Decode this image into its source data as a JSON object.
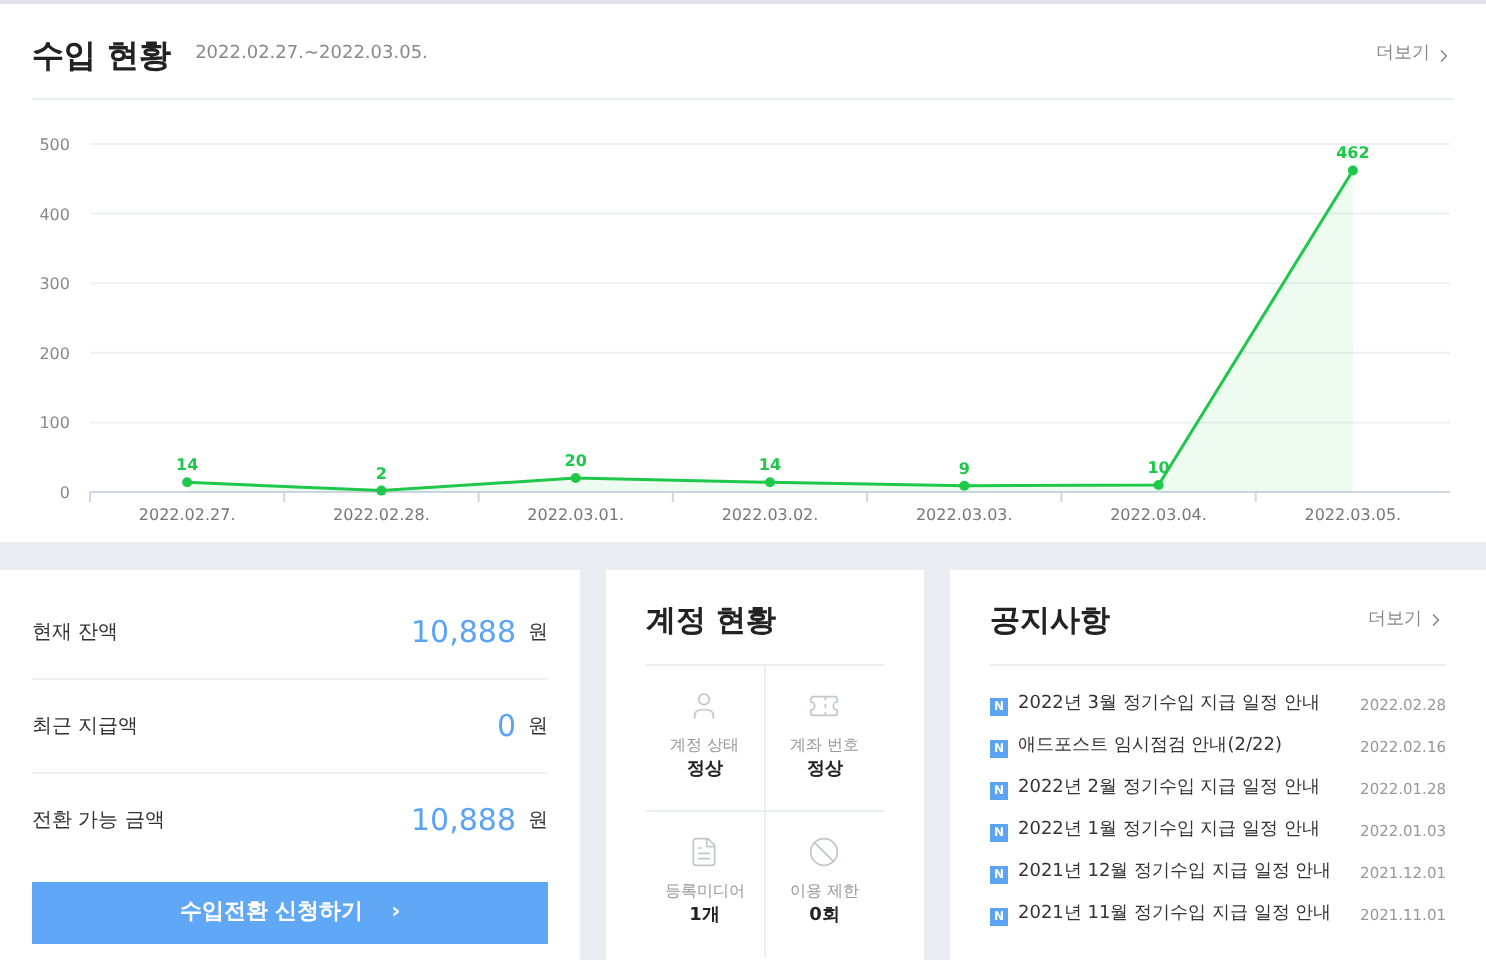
{
  "revenue": {
    "title": "수입 현황",
    "period": "2022.02.27.~2022.03.05.",
    "more": "더보기",
    "chart_data": {
      "type": "area",
      "categories": [
        "2022.02.27.",
        "2022.02.28.",
        "2022.03.01.",
        "2022.03.02.",
        "2022.03.03.",
        "2022.03.04.",
        "2022.03.05."
      ],
      "grid": true,
      "series": [
        {
          "color": "#1fc74a",
          "values": [
            14,
            2,
            20,
            14,
            9,
            10,
            462
          ]
        }
      ],
      "ylim": [
        0,
        500
      ],
      "yticks": [
        0,
        100,
        200,
        300,
        400,
        500
      ],
      "data_labels": true
    }
  },
  "balance": {
    "rows": [
      {
        "label": "현재 잔액",
        "amount": "10,888",
        "unit": "원"
      },
      {
        "label": "최근 지급액",
        "amount": "0",
        "unit": "원"
      },
      {
        "label": "전환 가능 금액",
        "amount": "10,888",
        "unit": "원"
      }
    ],
    "button": "수입전환 신청하기",
    "button_arrow": "›"
  },
  "account": {
    "title": "계정 현황",
    "items": [
      {
        "kind": "user",
        "label": "계정 상태",
        "value": "정상"
      },
      {
        "kind": "bank",
        "label": "계좌 번호",
        "value": "정상"
      },
      {
        "kind": "media",
        "label": "등록미디어",
        "value": "1개"
      },
      {
        "kind": "limit",
        "label": "이용 제한",
        "value": "0회"
      }
    ]
  },
  "notices": {
    "title": "공지사항",
    "more": "더보기",
    "items": [
      {
        "badge": "N",
        "title": "2022년 3월 정기수입 지급 일정 안내",
        "date": "2022.02.28"
      },
      {
        "badge": "N",
        "title": "애드포스트 임시점검 안내(2/22)",
        "date": "2022.02.16"
      },
      {
        "badge": "N",
        "title": "2022년 2월 정기수입 지급 일정 안내",
        "date": "2022.01.28"
      },
      {
        "badge": "N",
        "title": "2022년 1월 정기수입 지급 일정 안내",
        "date": "2022.01.03"
      },
      {
        "badge": "N",
        "title": "2021년 12월 정기수입 지급 일정 안내",
        "date": "2021.12.01"
      },
      {
        "badge": "N",
        "title": "2021년 11월 정기수입 지급 일정 안내",
        "date": "2021.11.01"
      }
    ]
  }
}
